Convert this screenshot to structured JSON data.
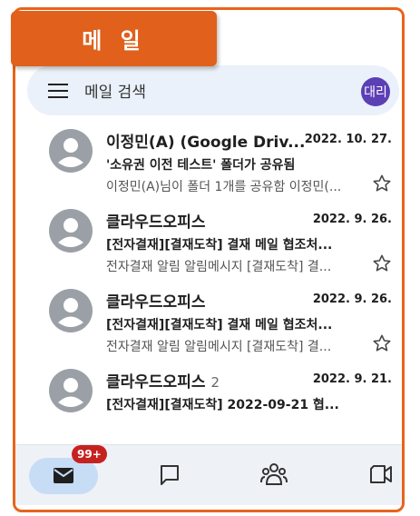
{
  "title_tab": {
    "label": "메 일"
  },
  "search": {
    "placeholder": "메일 검색",
    "account_initials": "대리"
  },
  "emails": [
    {
      "sender": "이정민(A) (Google Driv...",
      "count": "",
      "date": "2022. 10. 27.",
      "subject": "'소유권 이전 테스트' 폴더가 공유됨",
      "snippet": "이정민(A)님이 폴더 1개를 공유함 이정민(..."
    },
    {
      "sender": "클라우드오피스",
      "count": "",
      "date": "2022. 9. 26.",
      "subject": "[전자결재][결재도착] 결재 메일 협조처...",
      "snippet": "전자결재 알림 알림메시지 [결재도착] 결..."
    },
    {
      "sender": "클라우드오피스",
      "count": "",
      "date": "2022. 9. 26.",
      "subject": "[전자결재][결재도착] 결재 메일 협조처...",
      "snippet": "전자결재 알림 알림메시지 [결재도착] 결..."
    },
    {
      "sender": "클라우드오피스",
      "count": "2",
      "date": "2022. 9. 21.",
      "subject": "[전자결재][결재도착] 2022-09-21 협...",
      "snippet": ""
    }
  ],
  "bottom_nav": {
    "mail_badge": "99+",
    "items": [
      "mail-icon",
      "chat-icon",
      "spaces-icon",
      "meet-icon"
    ]
  },
  "colors": {
    "accent": "#e8641c",
    "avatar_me": "#5b3fb5",
    "badge": "#c5221f",
    "search_bg": "#eaf1fa"
  }
}
